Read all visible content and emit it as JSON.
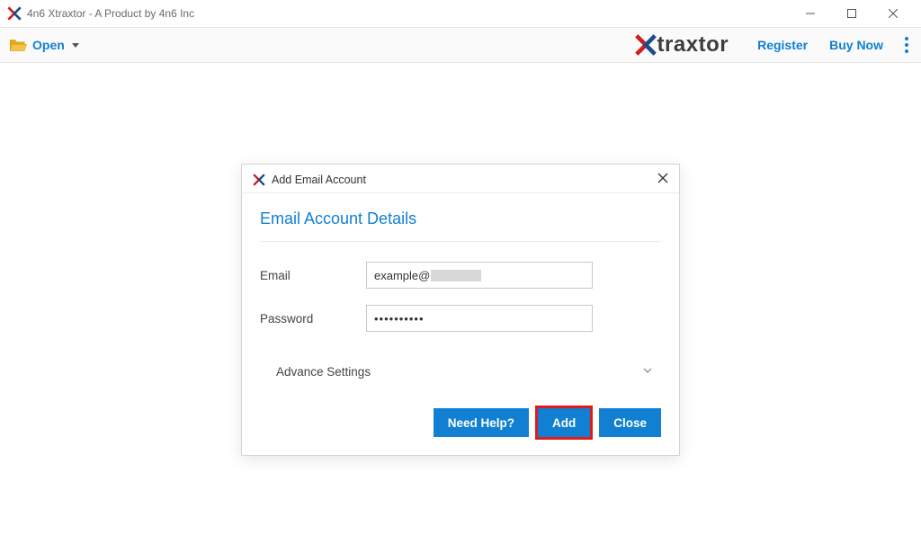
{
  "window": {
    "title": "4n6 Xtraxtor - A Product by 4n6 Inc"
  },
  "toolbar": {
    "open_label": "Open",
    "register_label": "Register",
    "buynow_label": "Buy Now",
    "brand_text": "traxtor"
  },
  "dialog": {
    "title": "Add Email Account",
    "heading": "Email Account Details",
    "email_label": "Email",
    "email_prefix": "example@",
    "password_label": "Password",
    "password_value": "••••••••••",
    "advance_label": "Advance Settings",
    "need_help": "Need Help?",
    "add": "Add",
    "close": "Close"
  }
}
